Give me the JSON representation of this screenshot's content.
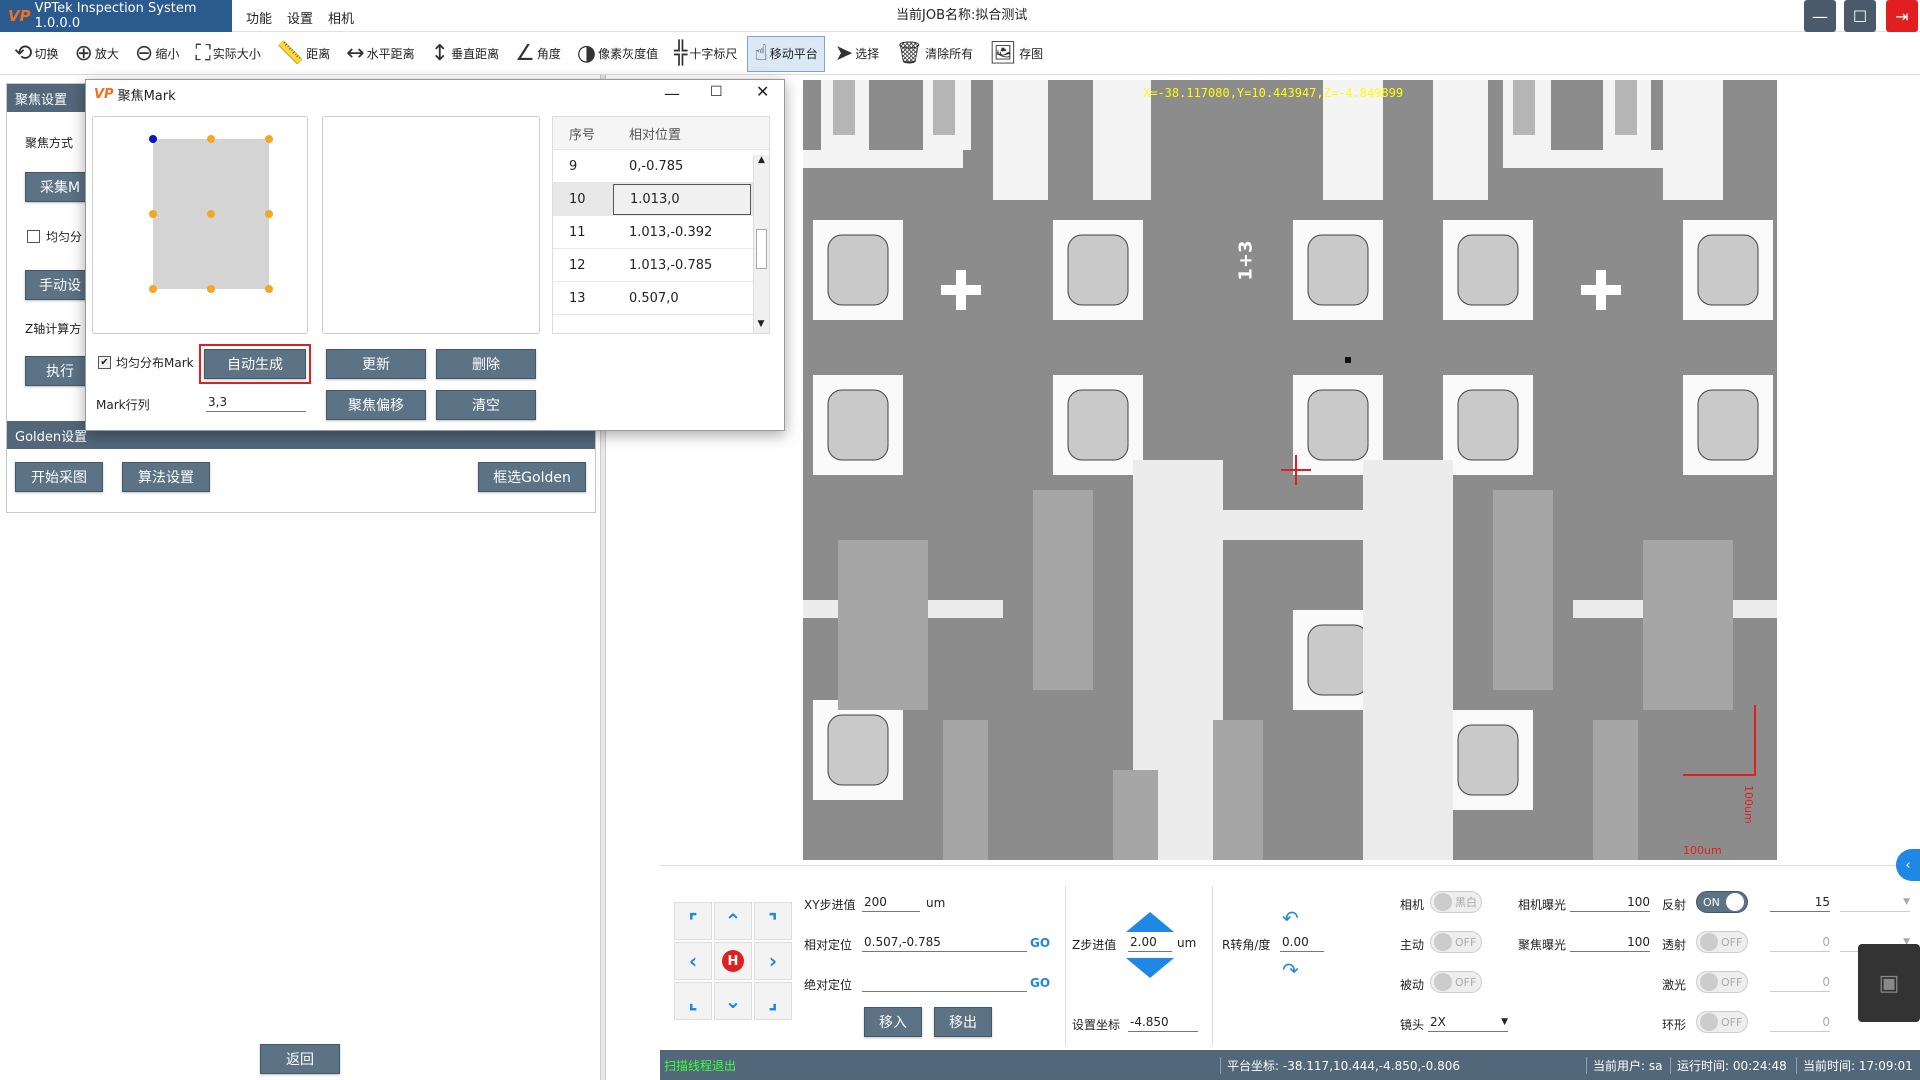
{
  "app": {
    "logo": "VP",
    "title": "VPTek Inspection System 1.0.0.0",
    "menus": [
      "功能",
      "设置",
      "相机"
    ],
    "job_label": "当前JOB名称:",
    "job_name": "拟合测试"
  },
  "toolbar": {
    "items": [
      {
        "icon": "switch-icon",
        "label": "切换"
      },
      {
        "icon": "zoom-in-icon",
        "label": "放大"
      },
      {
        "icon": "zoom-out-icon",
        "label": "缩小"
      },
      {
        "icon": "fullscreen-icon",
        "label": "实际大小"
      },
      {
        "icon": "ruler-icon",
        "label": "距离"
      },
      {
        "icon": "h-distance-icon",
        "label": "水平距离"
      },
      {
        "icon": "v-distance-icon",
        "label": "垂直距离"
      },
      {
        "icon": "angle-icon",
        "label": "角度"
      },
      {
        "icon": "gray-icon",
        "label": "像素灰度值"
      },
      {
        "icon": "crosshair-icon",
        "label": "十字标尺"
      },
      {
        "icon": "hand-icon",
        "label": "移动平台"
      },
      {
        "icon": "pointer-icon",
        "label": "选择"
      },
      {
        "icon": "trash-icon",
        "label": "清除所有"
      },
      {
        "icon": "image-icon",
        "label": "存图"
      }
    ]
  },
  "left": {
    "focus_section": "聚焦设置",
    "focus_mode": "聚焦方式",
    "collect_btn": "采集M",
    "uniform_check": "均匀分",
    "manual_btn": "手动设",
    "z_calc": "Z轴计算方",
    "exec_btn": "执行",
    "golden_section": "Golden设置",
    "start_capture": "开始采图",
    "algo_settings": "算法设置",
    "select_golden": "框选Golden",
    "return_btn": "返回"
  },
  "dialog": {
    "logo": "VP",
    "title": "聚焦Mark",
    "table_headers": [
      "序号",
      "相对位置"
    ],
    "rows": [
      {
        "idx": "9",
        "pos": "0,-0.785"
      },
      {
        "idx": "10",
        "pos": "1.013,0"
      },
      {
        "idx": "11",
        "pos": "1.013,-0.392"
      },
      {
        "idx": "12",
        "pos": "1.013,-0.785"
      },
      {
        "idx": "13",
        "pos": "0.507,0"
      }
    ],
    "uniform_label": "均匀分布Mark",
    "auto_btn": "自动生成",
    "update_btn": "更新",
    "delete_btn": "删除",
    "mark_rows_label": "Mark行列",
    "mark_rows_value": "3,3",
    "focus_offset_btn": "聚焦偏移",
    "clear_btn": "清空"
  },
  "image": {
    "coord_text": "X=-38.117080,Y=10.443947,Z=-4.849899",
    "scale_v": "100um",
    "scale_h": "100um",
    "cell_label": "1+3"
  },
  "motion": {
    "xy_step_label": "XY步进值",
    "xy_step_value": "200",
    "xy_unit": "um",
    "rel_label": "相对定位",
    "rel_value": "0.507,-0.785",
    "abs_label": "绝对定位",
    "abs_value": "",
    "go": "GO",
    "move_in": "移入",
    "move_out": "移出",
    "z_step_label": "Z步进值",
    "z_step_value": "2.00",
    "z_unit": "um",
    "set_coord_label": "设置坐标",
    "set_coord_value": "-4.850",
    "r_label": "R转角/度",
    "r_value": "0.00",
    "home": "H"
  },
  "camera": {
    "camera_label": "相机",
    "camera_toggle": "黑白",
    "active_label": "主动",
    "active_toggle": "OFF",
    "passive_label": "被动",
    "passive_toggle": "OFF",
    "lens_label": "镜头",
    "lens_value": "2X",
    "cam_exposure_label": "相机曝光",
    "cam_exposure_value": "100",
    "focus_exposure_label": "聚焦曝光",
    "focus_exposure_value": "100",
    "reflect_label": "反射",
    "reflect_toggle": "ON",
    "reflect_value": "15",
    "transmit_label": "透射",
    "transmit_toggle": "OFF",
    "transmit_value": "0",
    "laser_label": "激光",
    "laser_toggle": "OFF",
    "laser_value": "0",
    "ring_label": "环形",
    "ring_toggle": "OFF",
    "ring_value": "0"
  },
  "status": {
    "message": "扫描线程退出",
    "platform_label": "平台坐标:",
    "platform_value": "-38.117,10.444,-4.850,-0.806",
    "user_label": "当前用户:",
    "user_value": "sa",
    "runtime_label": "运行时间:",
    "runtime_value": "00:24:48",
    "time_label": "当前时间:",
    "time_value": "17:09:01"
  },
  "colors": {
    "accent": "#52677a",
    "highlight": "#e02020",
    "coord": "#ffff00",
    "go": "#1e88e5"
  }
}
